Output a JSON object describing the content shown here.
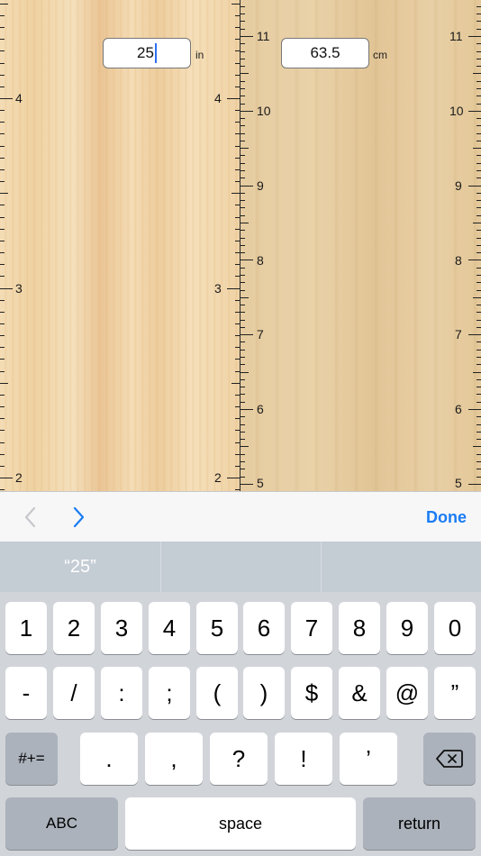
{
  "inches": {
    "value": "25",
    "unit": "in",
    "labels": [
      "4",
      "3",
      "2"
    ]
  },
  "centimeters": {
    "value": "63.5",
    "unit": "cm",
    "labels": [
      "11",
      "10",
      "9",
      "8",
      "7",
      "6",
      "5"
    ]
  },
  "toolbar": {
    "prev_icon": "chevron-left-icon",
    "next_icon": "chevron-right-icon",
    "done_label": "Done",
    "accent": "#1a7cf4"
  },
  "suggestions": [
    "“25”",
    "",
    ""
  ],
  "keyboard": {
    "row1": [
      "1",
      "2",
      "3",
      "4",
      "5",
      "6",
      "7",
      "8",
      "9",
      "0"
    ],
    "row2": [
      "-",
      "/",
      ":",
      ";",
      "(",
      ")",
      "$",
      "&",
      "@",
      "”"
    ],
    "row3_left": "#+=",
    "row3": [
      ".",
      ",",
      "?",
      "!",
      "’"
    ],
    "backspace_icon": "backspace-icon",
    "abc_label": "ABC",
    "space_label": "space",
    "return_label": "return"
  }
}
